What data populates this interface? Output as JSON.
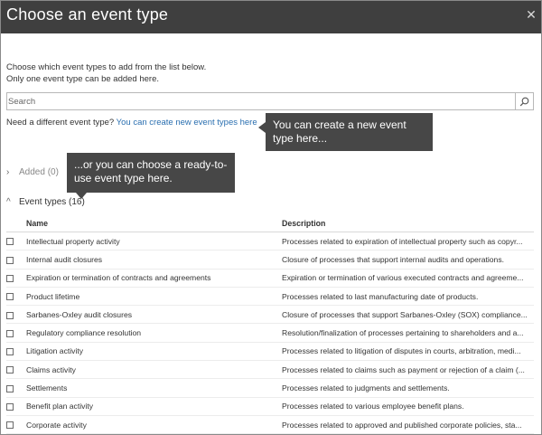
{
  "dialog": {
    "title": "Choose an event type",
    "close_glyph": "✕"
  },
  "intro": {
    "line1": "Choose which event types to add from the list below.",
    "line2": "Only one event type can be added here."
  },
  "search": {
    "placeholder": "Search",
    "value": ""
  },
  "create": {
    "prompt": "Need a different event type?",
    "link": "You can create new event types here"
  },
  "callouts": {
    "create": "You can create a new event type here...",
    "choose": "...or you can choose a ready-to-use event type here."
  },
  "sections": {
    "added": "Added (0)",
    "event_types": "Event types (16)"
  },
  "table": {
    "headers": {
      "name": "Name",
      "description": "Description"
    },
    "rows": [
      {
        "name": "Intellectual property activity",
        "description": "Processes related to expiration of intellectual property such as copyr..."
      },
      {
        "name": "Internal audit closures",
        "description": "Closure of processes that support internal audits and operations."
      },
      {
        "name": "Expiration or termination of contracts and agreements",
        "description": "Expiration or termination of various executed contracts and agreeme..."
      },
      {
        "name": "Product lifetime",
        "description": "Processes related to last manufacturing date of products."
      },
      {
        "name": "Sarbanes-Oxley audit closures",
        "description": "Closure of processes that support Sarbanes-Oxley (SOX) compliance..."
      },
      {
        "name": "Regulatory compliance resolution",
        "description": "Resolution/finalization of processes pertaining to shareholders and a..."
      },
      {
        "name": "Litigation activity",
        "description": "Processes related to litigation of disputes in courts, arbitration, medi..."
      },
      {
        "name": "Claims activity",
        "description": "Processes related to claims such as payment or rejection of a claim (..."
      },
      {
        "name": "Settlements",
        "description": "Processes related to judgments and settlements."
      },
      {
        "name": "Benefit plan activity",
        "description": "Processes related to various employee benefit plans."
      },
      {
        "name": "Corporate activity",
        "description": "Processes related to approved and published corporate policies, sta..."
      }
    ]
  },
  "icons": {
    "search": "search-icon",
    "close": "close-icon",
    "chevron_right": "›",
    "chevron_up": "^"
  },
  "colors": {
    "titlebar": "#3f3f3f",
    "callout": "#474747",
    "link": "#2a6fb0"
  }
}
